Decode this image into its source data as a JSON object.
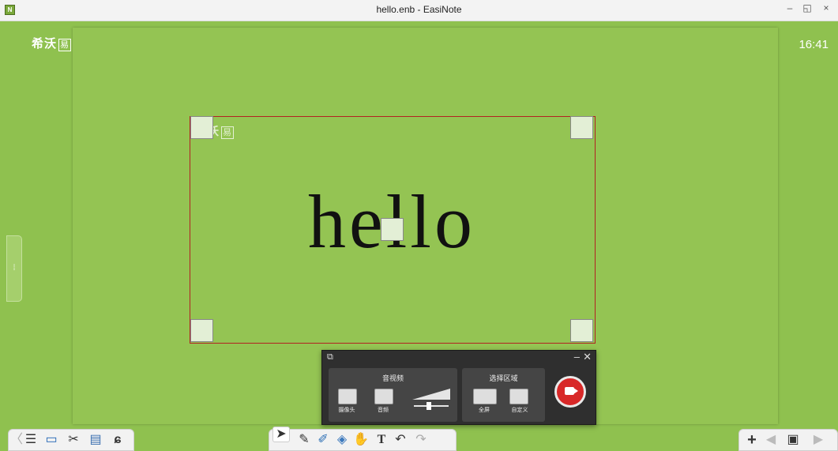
{
  "window": {
    "title": "hello.enb - EasiNote",
    "app_icon": "N",
    "minimize": "–",
    "restore": "◱",
    "close": "×"
  },
  "brand": {
    "logo_text": "希沃",
    "logo_box": "易"
  },
  "clock": "16:41",
  "slide": {
    "text": "hello"
  },
  "recorder": {
    "av_group_title": "音视频",
    "camera_label": "摄像头",
    "audio_label": "音频",
    "area_group_title": "选择区域",
    "fullscreen_label": "全屏",
    "custom_label": "自定义"
  },
  "colors": {
    "background": "#8fc14f",
    "canvas": "#94c453",
    "selection_border": "#b22222",
    "record": "#d82828"
  }
}
